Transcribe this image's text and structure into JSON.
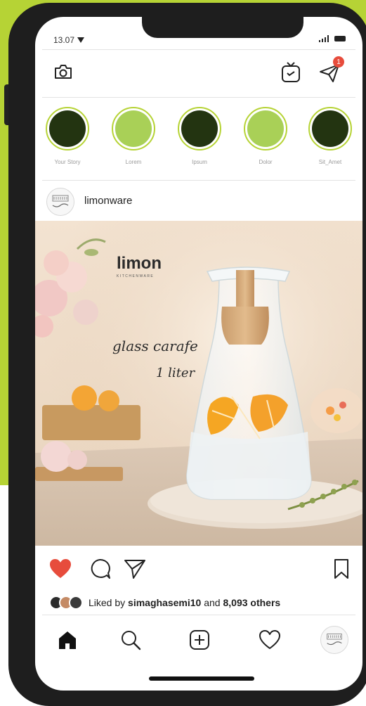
{
  "status_bar": {
    "time": "13.07"
  },
  "stories": [
    {
      "label": "Your Story",
      "color": "#233411"
    },
    {
      "label": "Lorem",
      "color": "#a9d057"
    },
    {
      "label": "Ipsum",
      "color": "#233411"
    },
    {
      "label": "Dolor",
      "color": "#a9d057"
    },
    {
      "label": "Sit_Amet",
      "color": "#233411"
    }
  ],
  "post": {
    "username": "limonware",
    "brand": "limon",
    "brand_sub": "KITCHENWARE",
    "caption_line1": "glass carafe",
    "caption_line2": "1 liter"
  },
  "notifications": {
    "badge_count": "1"
  },
  "likes": {
    "prefix": "Liked by",
    "user": "simaghasemi10",
    "middle": "and",
    "count": "8,093 others"
  },
  "colors": {
    "accent": "#b6d335",
    "like_red": "#e74c3c",
    "story_dark": "#233411",
    "story_light": "#a9d057"
  }
}
